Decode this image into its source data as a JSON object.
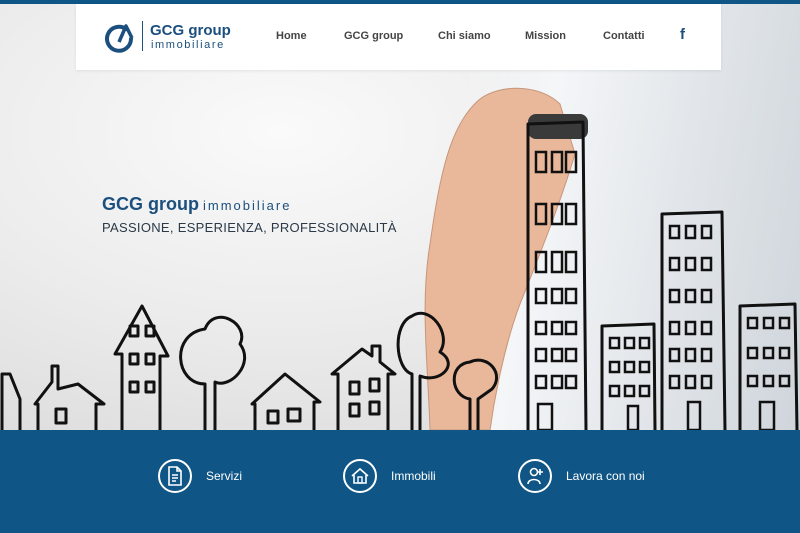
{
  "brand": {
    "name": "GCG group",
    "sub": "immobiliare",
    "accent": "#1b4f7e",
    "footer_color": "#0f5585"
  },
  "nav": {
    "items": [
      {
        "label": "Home"
      },
      {
        "label": "GCG group"
      },
      {
        "label": "Chi siamo"
      },
      {
        "label": "Mission"
      },
      {
        "label": "Contatti"
      }
    ],
    "social_icon": "facebook-icon",
    "social_glyph": "f"
  },
  "hero": {
    "name": "GCG group",
    "sub": "immobiliare",
    "slogan": "PASSIONE, ESPERIENZA, PROFESSIONALITÀ"
  },
  "footer": {
    "items": [
      {
        "label": "Servizi",
        "icon": "document-icon"
      },
      {
        "label": "Immobili",
        "icon": "house-icon"
      },
      {
        "label": "Lavora con noi",
        "icon": "person-add-icon"
      }
    ]
  }
}
